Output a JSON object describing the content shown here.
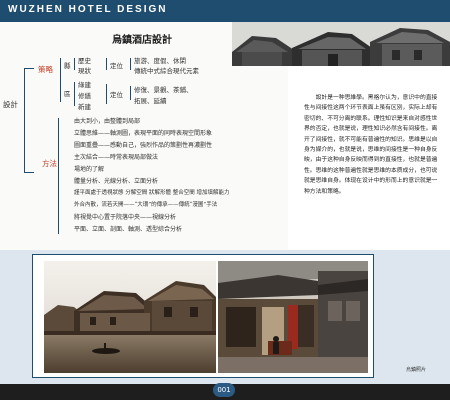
{
  "header": {
    "title": "WUZHEN HOTEL DESIGN"
  },
  "page": {
    "title": "烏鎮酒店設計",
    "number": "001"
  },
  "mindmap": {
    "root": "設計",
    "strategy": {
      "label": "策略",
      "g1_label": "縣",
      "g1_items": [
        "歷史",
        "現狀"
      ],
      "g1_mid": "定位",
      "g1_results": [
        "旅游、度假、休閑",
        "傳統中式綜合現代元素"
      ],
      "g2_label": "區",
      "g2_items": [
        "綠建",
        "修繕",
        "新建"
      ],
      "g2_mid": "定位",
      "g2_results": [
        "修復、景觀、茶鋪、",
        "拓展、延續"
      ]
    },
    "method": {
      "label": "方法",
      "items": [
        "由大到小，由整體到局部",
        "立體思維——軸測圖，表現平面的同時表現空間形象",
        "圖面重疊——感動自己，強烈作品的策劃性再濃劃性",
        "主次結合——時常表現局部做法",
        "場地的了解",
        "體量分析、光線分析、立面分析",
        "謹平面處于透視狀態 分解空間 狀解形體 整合空間 增加填解能力",
        "外合內散，流若天開——“大環”的傳承——傳統“漫圖”手法",
        "將視覺中心置于院落中央——視線分析",
        "平面、立面、剖面、軸測、透型綜合分析"
      ]
    }
  },
  "description": "設計是一种思維學。黑格尔认为，意识中的直接性与间接性这两个环节表面上虽有区別，实际上却有密切的、不可分离的联系。理性知识是来自对感性世界的否定，也就是说，理性知识必然含有间接性。离开了间接性，就不可能有普遍性的知识。思维是以自身为媒介的，也就是说，思维的间接性是一种自身反映，由于这种自身反映而得到的直接性，也就是普遍性。思维的这种普遍性就是思维的本质成分，也可说就是思维自身。体现在设计中的形而上的意识就是一种方法和策略。",
  "caption": "烏鎮照片"
}
